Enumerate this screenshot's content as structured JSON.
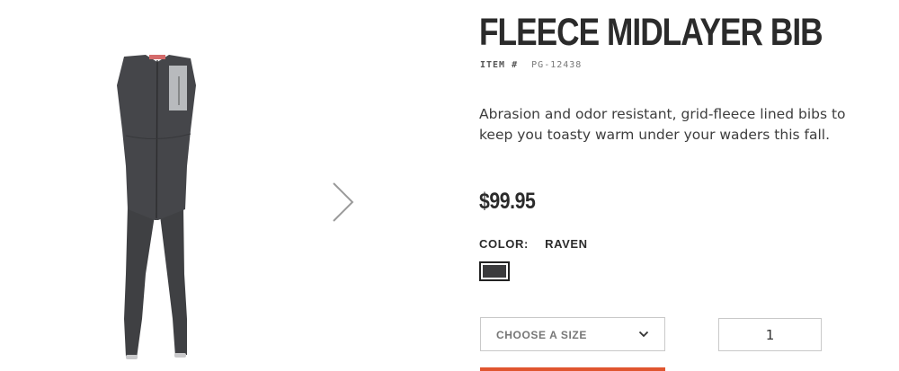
{
  "product": {
    "title": "FLEECE MIDLAYER BIB",
    "item_label": "ITEM #",
    "item_number": "PG-12438",
    "description": "Abrasion and odor resistant, grid-fleece lined bibs to keep you toasty warm under your waders this fall.",
    "price": "$99.95",
    "color_label": "COLOR:",
    "color_value": "RAVEN",
    "swatch_color": "#3b3b3d",
    "size_placeholder": "CHOOSE A SIZE",
    "quantity": "1",
    "accent_color": "#e0552f"
  },
  "gallery": {
    "image_icon": "fleece-bib-image",
    "next_icon": "chevron-right-icon"
  }
}
